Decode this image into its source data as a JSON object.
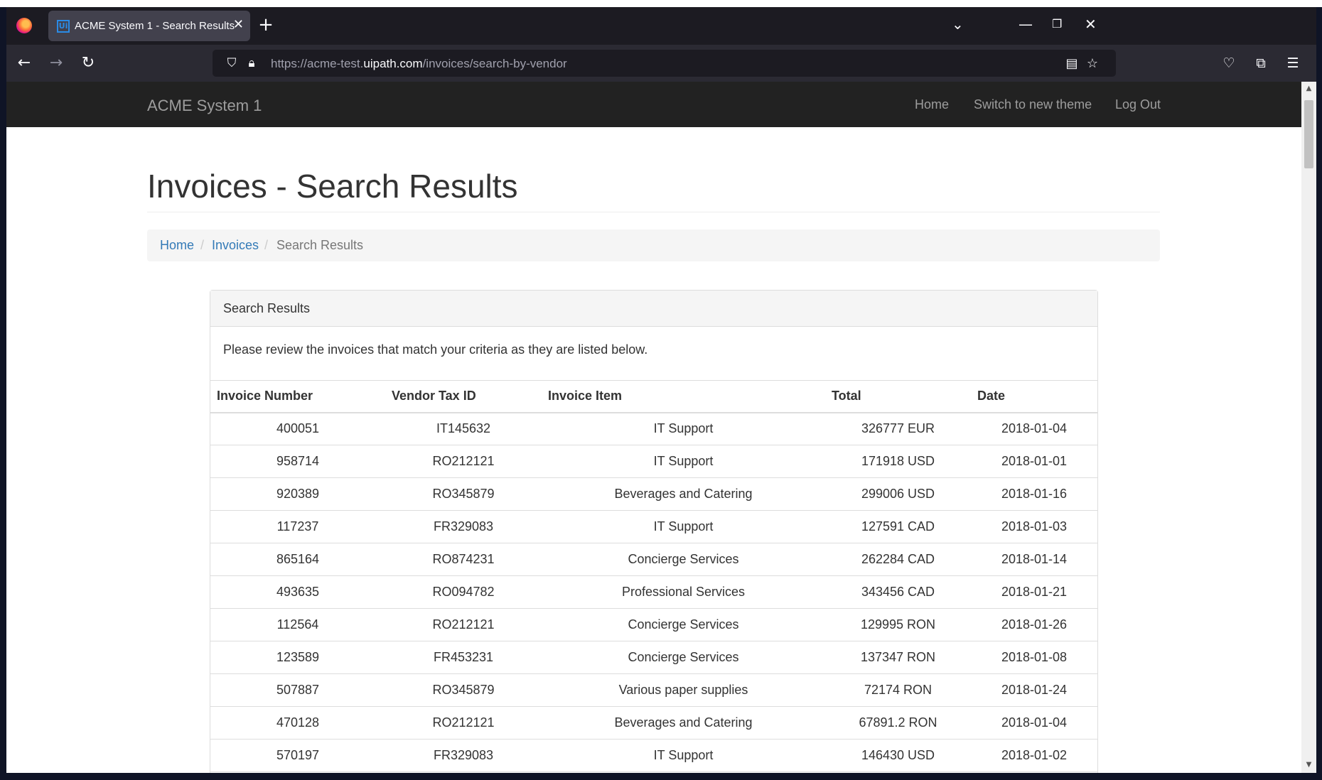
{
  "browser": {
    "tab_title": "ACME System 1 - Search Results",
    "favicon_text": "Ui",
    "url_prefix": "https://acme-test.",
    "url_host": "uipath.com",
    "url_path": "/invoices/search-by-vendor",
    "accent_color": "#2a8be6"
  },
  "site": {
    "brand": "ACME System 1",
    "nav": [
      "Home",
      "Switch to new theme",
      "Log Out"
    ]
  },
  "page": {
    "title": "Invoices - Search Results",
    "breadcrumb": [
      "Home",
      "Invoices",
      "Search Results"
    ],
    "panel_heading": "Search Results",
    "intro": "Please review the invoices that match your criteria as they are listed below."
  },
  "table": {
    "headers": [
      "Invoice Number",
      "Vendor Tax ID",
      "Invoice Item",
      "Total",
      "Date"
    ],
    "rows": [
      [
        "400051",
        "IT145632",
        "IT Support",
        "326777 EUR",
        "2018-01-04"
      ],
      [
        "958714",
        "RO212121",
        "IT Support",
        "171918 USD",
        "2018-01-01"
      ],
      [
        "920389",
        "RO345879",
        "Beverages and Catering",
        "299006 USD",
        "2018-01-16"
      ],
      [
        "117237",
        "FR329083",
        "IT Support",
        "127591 CAD",
        "2018-01-03"
      ],
      [
        "865164",
        "RO874231",
        "Concierge Services",
        "262284 CAD",
        "2018-01-14"
      ],
      [
        "493635",
        "RO094782",
        "Professional Services",
        "343456 CAD",
        "2018-01-21"
      ],
      [
        "112564",
        "RO212121",
        "Concierge Services",
        "129995 RON",
        "2018-01-26"
      ],
      [
        "123589",
        "FR453231",
        "Concierge Services",
        "137347 RON",
        "2018-01-08"
      ],
      [
        "507887",
        "RO345879",
        "Various paper supplies",
        "72174 RON",
        "2018-01-24"
      ],
      [
        "470128",
        "RO212121",
        "Beverages and Catering",
        "67891.2 RON",
        "2018-01-04"
      ],
      [
        "570197",
        "FR329083",
        "IT Support",
        "146430 USD",
        "2018-01-02"
      ]
    ]
  }
}
